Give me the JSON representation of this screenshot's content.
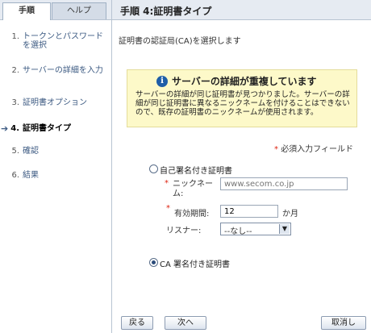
{
  "sidebar": {
    "tabs": [
      {
        "label": "手順"
      },
      {
        "label": "ヘルプ"
      }
    ],
    "steps": [
      {
        "num": "1.",
        "label": "トークンとパスワードを選択"
      },
      {
        "num": "2.",
        "label": "サーバーの詳細を入力"
      },
      {
        "num": "3.",
        "label": "証明書オプション"
      },
      {
        "num": "4.",
        "label": "証明書タイプ",
        "current": true,
        "arrow": "➔"
      },
      {
        "num": "5.",
        "label": "確認"
      },
      {
        "num": "6.",
        "label": "結果"
      }
    ]
  },
  "header": {
    "title": "手順 4:証明書タイプ"
  },
  "main": {
    "description": "証明書の認証局(CA)を選択します",
    "warning": {
      "icon": "info-icon",
      "title": "サーバーの詳細が重複しています",
      "body": "サーバーの詳細が同じ証明書が見つかりました。サーバーの詳細が同じ証明書に異なるニックネームを付けることはできないので、既存の証明書のニックネームが使用されます。"
    },
    "required_note": "必須入力フィールド",
    "required_star": "*",
    "self_signed": {
      "label": "自己署名付き証明書",
      "checked": false,
      "nickname_label": "ニックネーム:",
      "nickname_placeholder": "www.secom.co.jp",
      "validity_label": "有効期間:",
      "validity_value": "12",
      "validity_unit": "か月",
      "listener_label": "リスナー:",
      "listener_value": "--なし--"
    },
    "ca_signed": {
      "label": "CA 署名付き証明書",
      "checked": true
    }
  },
  "buttons": {
    "back": "戻る",
    "next": "次へ",
    "cancel": "取消し"
  },
  "colors": {
    "accent": "#1f5ea8",
    "required": "#dd2211",
    "warning_bg": "#fdf9c9"
  }
}
